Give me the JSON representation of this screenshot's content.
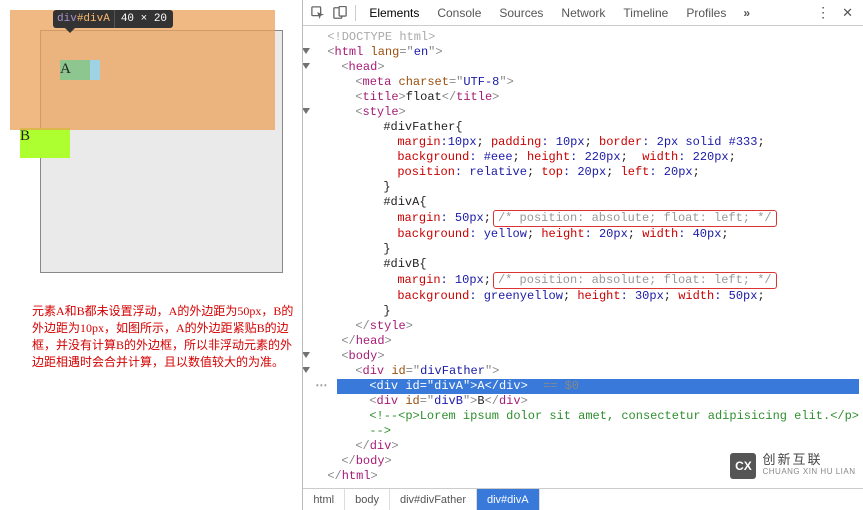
{
  "tooltip": {
    "tag": "div",
    "id": "#divA",
    "dims": "40 × 20"
  },
  "preview": {
    "labelA": "A",
    "labelB": "B"
  },
  "explanation": "元素A和B都未设置浮动，A的外边距为50px，B的外边距为10px，如图所示，A的外边距紧贴B的边框，并没有计算B的外边框，所以非浮动元素的外边距相遇时会合并计算，且以数值较大的为准。",
  "devtools": {
    "tabs": [
      "Elements",
      "Console",
      "Sources",
      "Network",
      "Timeline",
      "Profiles"
    ],
    "more": "»",
    "vdots": "⋮",
    "close": "✕"
  },
  "dom": {
    "doctype": "<!DOCTYPE html>",
    "html_open_tag": "html",
    "html_attr_name": "lang",
    "html_attr_val": "en",
    "head": "head",
    "meta_tag": "meta",
    "meta_attr": "charset",
    "meta_val": "UTF-8",
    "title_tag": "title",
    "title_text": "float",
    "style_tag": "style",
    "css": {
      "father_sel": "#divFather{",
      "father_l1_props": "margin:10px; padding: 10px; border: 2px solid #333;",
      "father_l1_p1": "margin",
      "father_l1_v1": ":10px",
      "father_l1_p2": "padding",
      "father_l1_v2": ": 10px",
      "father_l1_p3": "border",
      "father_l1_v3": ": 2px solid #333",
      "father_l2_p1": "background",
      "father_l2_v1": ": #eee",
      "father_l2_p2": "height",
      "father_l2_v2": ": 220px",
      "father_l2_p3": "width",
      "father_l2_v3": ": 220px",
      "father_l3_p1": "position",
      "father_l3_v1": ": relative",
      "father_l3_p2": "top",
      "father_l3_v2": ": 20px",
      "father_l3_p3": "left",
      "father_l3_v3": ": 20px",
      "divA_sel": "#divA{",
      "divA_l1_p1": "margin",
      "divA_l1_v1": ": 50px",
      "divA_annot": "/* position: absolute; float: left; */",
      "divA_l2_p1": "background",
      "divA_l2_v1": ": yellow",
      "divA_l2_p2": "height",
      "divA_l2_v2": ": 20px",
      "divA_l2_p3": "width",
      "divA_l2_v3": ": 40px",
      "divB_sel": "#divB{",
      "divB_l1_p1": "margin",
      "divB_l1_v1": ": 10px",
      "divB_annot": "/* position: absolute; float: left; */",
      "divB_l2_p1": "background",
      "divB_l2_v1": ": greenyellow",
      "divB_l2_p2": "height",
      "divB_l2_v2": ": 30px",
      "divB_l2_p3": "width",
      "divB_l2_v3": ": 50px",
      "close_brace": "}"
    },
    "body": "body",
    "divFather_tag": "div",
    "divFather_id_attr": "id",
    "divFather_id_val": "divFather",
    "divA_tag": "div",
    "divA_id_attr": "id",
    "divA_id_val": "divA",
    "divA_text": "A",
    "eqdom": " == $0",
    "divB_tag": "div",
    "divB_id_attr": "id",
    "divB_id_val": "divB",
    "divB_text": "B",
    "comment": "<!--<p>Lorem ipsum dolor sit amet, consectetur adipisicing elit.</p>\n-->"
  },
  "crumbs": [
    "html",
    "body",
    "div#divFather",
    "div#divA"
  ],
  "watermark": {
    "logo": "CX",
    "zh": "创新互联",
    "en": "CHUANG XIN HU LIAN"
  }
}
